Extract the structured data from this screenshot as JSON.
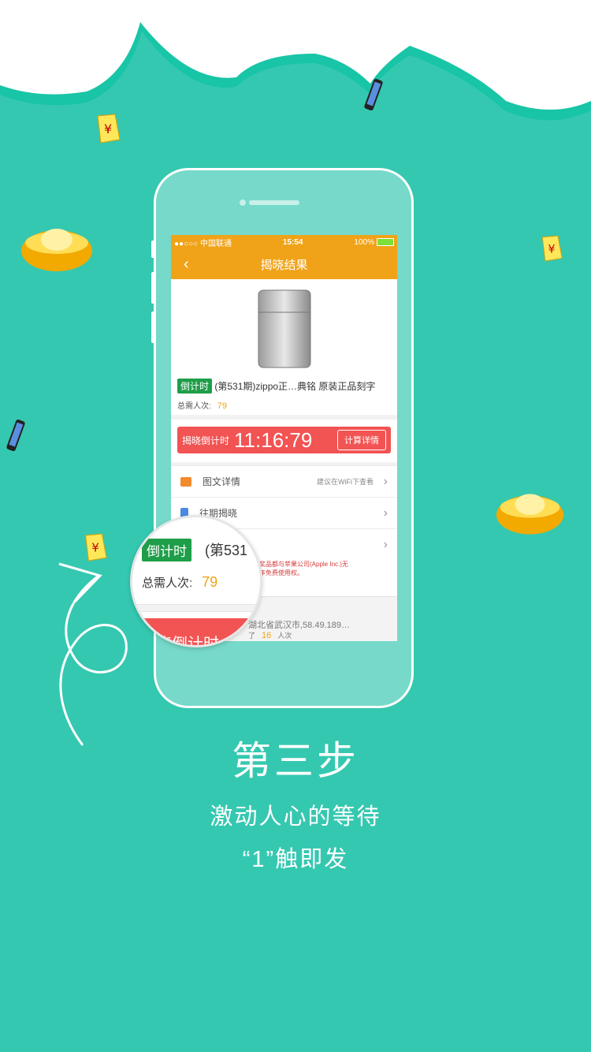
{
  "colors": {
    "background": "#35c8b0",
    "cloud": "#ffffff",
    "cloud_edge": "#18c5a6",
    "app_orange": "#f0a318",
    "tag_green": "#1f9e49",
    "countdown_red": "#f25353"
  },
  "status_bar": {
    "carrier": "●●○○○ 中国联通",
    "time": "15:54",
    "battery": "100%"
  },
  "nav": {
    "title": "揭晓结果",
    "back_icon": "chevron-left-icon"
  },
  "product": {
    "tag": "倒计时",
    "title": "(第531期)zippo正…典铭 原装正品刻字",
    "need_label": "总需人次:",
    "need_value": "79"
  },
  "countdown": {
    "label": "揭晓倒计时",
    "time": "11:16:79",
    "button": "计算详情"
  },
  "list": [
    {
      "label": "图文详情",
      "hint": "建议在WiFi下查看",
      "icon": "image-icon"
    },
    {
      "label": "往期揭晓",
      "hint": "",
      "icon": "document-icon"
    },
    {
      "label": "",
      "hint": "",
      "icon": ""
    }
  ],
  "notice": "动和奖品都与苹果公司(Apple Inc.)无\n的十年免费使用权。",
  "record": {
    "line1": "湖北省武汉市,58.49.189…",
    "line2_prefix": "了",
    "line2_value": "16",
    "line2_suffix": "人次"
  },
  "magnifier": {
    "tag": "倒计时",
    "title": "(第531",
    "need_label": "总需人次:",
    "need_value": "79",
    "red_text": "揭晓倒计时"
  },
  "caption": {
    "step": "第三步",
    "line1": "激动人心的等待",
    "line2": "“1”触即发"
  }
}
